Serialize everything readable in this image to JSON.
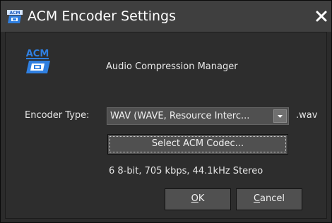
{
  "window": {
    "title": "ACM Encoder Settings",
    "close_icon": "close-icon",
    "title_icon": "acm-app-icon"
  },
  "header": {
    "logo_text": "ACM",
    "subtitle": "Audio Compression Manager"
  },
  "encoder": {
    "label": "Encoder Type:",
    "selected": "WAV (WAVE, Resource Interc...",
    "extension": ".wav",
    "select_codec_label": "Select ACM Codec...",
    "format_info": "6 8-bit, 705 kbps, 44.1kHz Stereo"
  },
  "buttons": {
    "ok_accel": "O",
    "ok_rest": "K",
    "cancel_accel": "C",
    "cancel_rest": "ancel"
  },
  "colors": {
    "window_bg": "#2b2b2b",
    "titlebar_bg": "#3f3f3f",
    "control_bg": "#505050",
    "text": "#e6e6e6",
    "logo_blue": "#2f7fe0"
  }
}
